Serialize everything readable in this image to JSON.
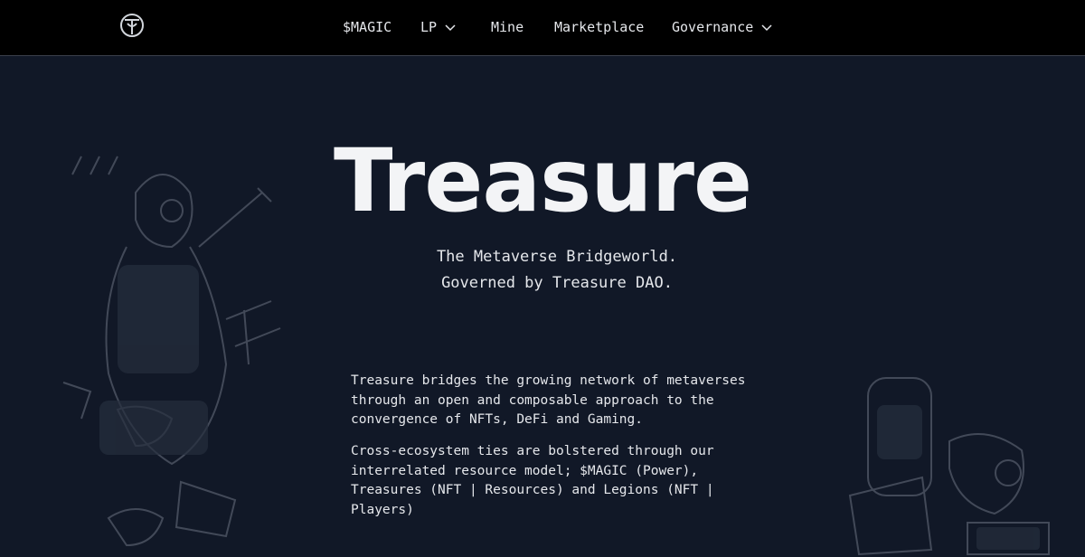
{
  "nav": {
    "logo_icon": "treasure-logo-icon",
    "items": [
      {
        "label": "$MAGIC",
        "has_dropdown": false
      },
      {
        "label": "LP",
        "has_dropdown": true
      },
      {
        "label": "Mine",
        "has_dropdown": false
      },
      {
        "label": "Marketplace",
        "has_dropdown": false
      },
      {
        "label": "Governance",
        "has_dropdown": true
      }
    ]
  },
  "hero": {
    "title": "Treasure",
    "subtitle_line1": "The Metaverse Bridgeworld.",
    "subtitle_line2": "Governed by Treasure DAO.",
    "paragraph1": "Treasure bridges the growing network of metaverses through an open and composable approach to the convergence of NFTs, DeFi and Gaming.",
    "paragraph2": "Cross-ecosystem ties are bolstered through our interrelated resource model; $MAGIC (Power), Treasures (NFT | Resources) and Legions (NFT | Players)"
  },
  "colors": {
    "background": "#111827",
    "topbar": "#000000",
    "text": "#e5e7eb"
  }
}
